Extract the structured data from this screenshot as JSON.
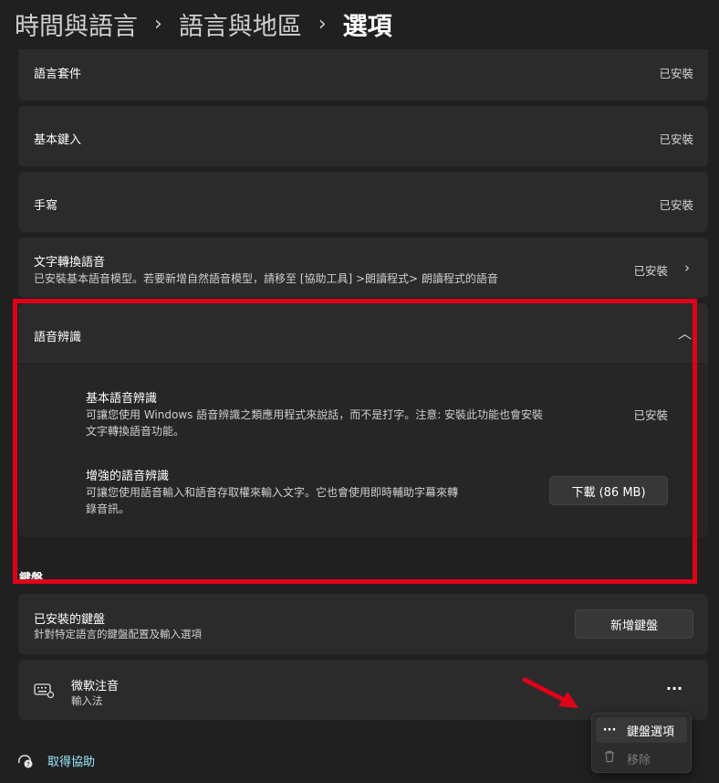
{
  "breadcrumb": {
    "items": [
      "時間與語言",
      "語言與地區",
      "選項"
    ],
    "separator": "›"
  },
  "features": [
    {
      "title": "語言套件",
      "status": "已安裝"
    },
    {
      "title": "基本鍵入",
      "status": "已安裝"
    },
    {
      "title": "手寫",
      "status": "已安裝"
    },
    {
      "title": "文字轉換語音",
      "subtitle": "已安裝基本語音模型。若要新增自然語音模型，請移至 [協助工具] >朗讀程式> 朗讀程式的語音",
      "status": "已安裝"
    }
  ],
  "speech": {
    "title": "語音辨識",
    "basic": {
      "title": "基本語音辨識",
      "desc_line1": "可讓您使用 Windows 語音辨識之類應用程式來說話，而不是打字。注意: 安裝此功能也會安裝",
      "desc_line2": "文字轉換語音功能。",
      "status": "已安裝"
    },
    "enhanced": {
      "title": "增強的語音辨識",
      "desc_line1": "可讓您使用語音輸入和語音存取權來輸入文字。它也會使用即時輔助字幕來轉",
      "desc_line2": "錄音訊。",
      "button": "下載 (86 MB)"
    }
  },
  "keyboard_section": {
    "heading": "鍵盤",
    "installed": {
      "title": "已安裝的鍵盤",
      "subtitle": "針對特定語言的鍵盤配置及輸入選項",
      "button": "新增鍵盤"
    },
    "ime": {
      "title": "微軟注音",
      "subtitle": "輸入法",
      "more": "···"
    }
  },
  "context_menu": {
    "items": [
      {
        "icon": "···",
        "label": "鍵盤選項",
        "enabled": true
      },
      {
        "icon": "🗑",
        "label": "移除",
        "enabled": false
      }
    ]
  },
  "help": {
    "label": "取得協助"
  },
  "colors": {
    "highlight_box": "#e0001a",
    "arrow": "#e0001a",
    "link": "#99ebff"
  }
}
